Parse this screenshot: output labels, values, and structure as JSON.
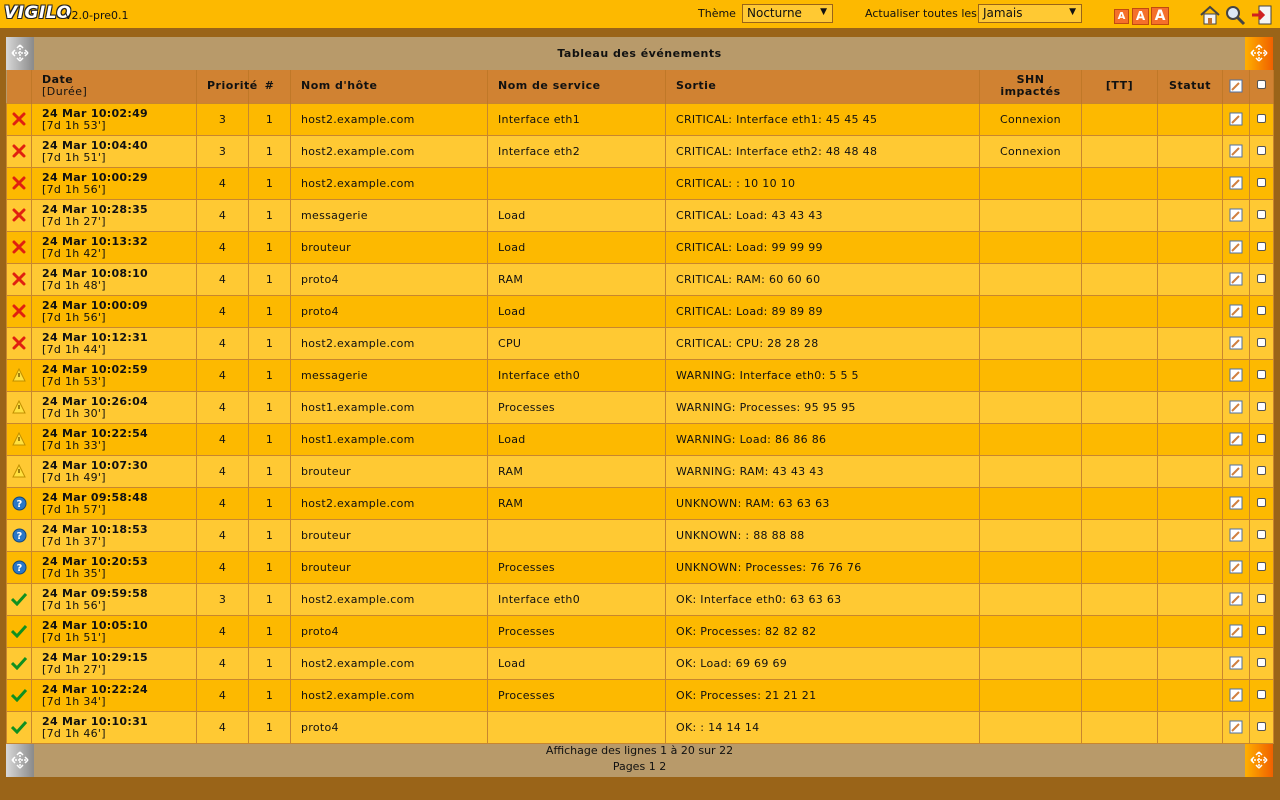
{
  "app": {
    "logo": "VIGILO",
    "version": "v2.0-pre0.1"
  },
  "toolbar": {
    "theme_label": "Thème",
    "theme_value": "Nocturne",
    "refresh_label": "Actualiser toutes les",
    "refresh_value": "Jamais",
    "font_sizes": [
      "A",
      "A",
      "A"
    ]
  },
  "panel": {
    "title": "Tableau des événements"
  },
  "columns": {
    "date": "Date",
    "date_sub": "[Durée]",
    "priority": "Priorité",
    "count": "#",
    "host": "Nom d'hôte",
    "service": "Nom de service",
    "output": "Sortie",
    "shn1": "SHN",
    "shn2": "impactés",
    "tt": "[TT]",
    "status": "Statut"
  },
  "rows": [
    {
      "state": "critical",
      "date": "24 Mar 10:02:49",
      "duration": "[7d 1h 53']",
      "priority": "3",
      "count": "1",
      "host": "host2.example.com",
      "service": "Interface eth1",
      "output": "CRITICAL: Interface eth1: 45 45 45",
      "shn": "Connexion",
      "tt": "",
      "status": ""
    },
    {
      "state": "critical",
      "date": "24 Mar 10:04:40",
      "duration": "[7d 1h 51']",
      "priority": "3",
      "count": "1",
      "host": "host2.example.com",
      "service": "Interface eth2",
      "output": "CRITICAL: Interface eth2: 48 48 48",
      "shn": "Connexion",
      "tt": "",
      "status": ""
    },
    {
      "state": "critical",
      "date": "24 Mar 10:00:29",
      "duration": "[7d 1h 56']",
      "priority": "4",
      "count": "1",
      "host": "host2.example.com",
      "service": "",
      "output": "CRITICAL: : 10 10 10",
      "shn": "",
      "tt": "",
      "status": ""
    },
    {
      "state": "critical",
      "date": "24 Mar 10:28:35",
      "duration": "[7d 1h 27']",
      "priority": "4",
      "count": "1",
      "host": "messagerie",
      "service": "Load",
      "output": "CRITICAL: Load: 43 43 43",
      "shn": "",
      "tt": "",
      "status": ""
    },
    {
      "state": "critical",
      "date": "24 Mar 10:13:32",
      "duration": "[7d 1h 42']",
      "priority": "4",
      "count": "1",
      "host": "brouteur",
      "service": "Load",
      "output": "CRITICAL: Load: 99 99 99",
      "shn": "",
      "tt": "",
      "status": ""
    },
    {
      "state": "critical",
      "date": "24 Mar 10:08:10",
      "duration": "[7d 1h 48']",
      "priority": "4",
      "count": "1",
      "host": "proto4",
      "service": "RAM",
      "output": "CRITICAL: RAM: 60 60 60",
      "shn": "",
      "tt": "",
      "status": ""
    },
    {
      "state": "critical",
      "date": "24 Mar 10:00:09",
      "duration": "[7d 1h 56']",
      "priority": "4",
      "count": "1",
      "host": "proto4",
      "service": "Load",
      "output": "CRITICAL: Load: 89 89 89",
      "shn": "",
      "tt": "",
      "status": ""
    },
    {
      "state": "critical",
      "date": "24 Mar 10:12:31",
      "duration": "[7d 1h 44']",
      "priority": "4",
      "count": "1",
      "host": "host2.example.com",
      "service": "CPU",
      "output": "CRITICAL: CPU: 28 28 28",
      "shn": "",
      "tt": "",
      "status": ""
    },
    {
      "state": "warning",
      "date": "24 Mar 10:02:59",
      "duration": "[7d 1h 53']",
      "priority": "4",
      "count": "1",
      "host": "messagerie",
      "service": "Interface eth0",
      "output": "WARNING: Interface eth0: 5 5 5",
      "shn": "",
      "tt": "",
      "status": ""
    },
    {
      "state": "warning",
      "date": "24 Mar 10:26:04",
      "duration": "[7d 1h 30']",
      "priority": "4",
      "count": "1",
      "host": "host1.example.com",
      "service": "Processes",
      "output": "WARNING: Processes: 95 95 95",
      "shn": "",
      "tt": "",
      "status": ""
    },
    {
      "state": "warning",
      "date": "24 Mar 10:22:54",
      "duration": "[7d 1h 33']",
      "priority": "4",
      "count": "1",
      "host": "host1.example.com",
      "service": "Load",
      "output": "WARNING: Load: 86 86 86",
      "shn": "",
      "tt": "",
      "status": ""
    },
    {
      "state": "warning",
      "date": "24 Mar 10:07:30",
      "duration": "[7d 1h 49']",
      "priority": "4",
      "count": "1",
      "host": "brouteur",
      "service": "RAM",
      "output": "WARNING: RAM: 43 43 43",
      "shn": "",
      "tt": "",
      "status": ""
    },
    {
      "state": "unknown",
      "date": "24 Mar 09:58:48",
      "duration": "[7d 1h 57']",
      "priority": "4",
      "count": "1",
      "host": "host2.example.com",
      "service": "RAM",
      "output": "UNKNOWN: RAM: 63 63 63",
      "shn": "",
      "tt": "",
      "status": ""
    },
    {
      "state": "unknown",
      "date": "24 Mar 10:18:53",
      "duration": "[7d 1h 37']",
      "priority": "4",
      "count": "1",
      "host": "brouteur",
      "service": "",
      "output": "UNKNOWN: : 88 88 88",
      "shn": "",
      "tt": "",
      "status": ""
    },
    {
      "state": "unknown",
      "date": "24 Mar 10:20:53",
      "duration": "[7d 1h 35']",
      "priority": "4",
      "count": "1",
      "host": "brouteur",
      "service": "Processes",
      "output": "UNKNOWN: Processes: 76 76 76",
      "shn": "",
      "tt": "",
      "status": ""
    },
    {
      "state": "ok",
      "date": "24 Mar 09:59:58",
      "duration": "[7d 1h 56']",
      "priority": "3",
      "count": "1",
      "host": "host2.example.com",
      "service": "Interface eth0",
      "output": "OK: Interface eth0: 63 63 63",
      "shn": "",
      "tt": "",
      "status": ""
    },
    {
      "state": "ok",
      "date": "24 Mar 10:05:10",
      "duration": "[7d 1h 51']",
      "priority": "4",
      "count": "1",
      "host": "proto4",
      "service": "Processes",
      "output": "OK: Processes: 82 82 82",
      "shn": "",
      "tt": "",
      "status": ""
    },
    {
      "state": "ok",
      "date": "24 Mar 10:29:15",
      "duration": "[7d 1h 27']",
      "priority": "4",
      "count": "1",
      "host": "host2.example.com",
      "service": "Load",
      "output": "OK: Load: 69 69 69",
      "shn": "",
      "tt": "",
      "status": ""
    },
    {
      "state": "ok",
      "date": "24 Mar 10:22:24",
      "duration": "[7d 1h 34']",
      "priority": "4",
      "count": "1",
      "host": "host2.example.com",
      "service": "Processes",
      "output": "OK: Processes: 21 21 21",
      "shn": "",
      "tt": "",
      "status": ""
    },
    {
      "state": "ok",
      "date": "24 Mar 10:10:31",
      "duration": "[7d 1h 46']",
      "priority": "4",
      "count": "1",
      "host": "proto4",
      "service": "",
      "output": "OK: : 14 14 14",
      "shn": "",
      "tt": "",
      "status": ""
    }
  ],
  "pager": {
    "summary": "Affichage des lignes 1 à 20 sur 22",
    "pages_label": "Pages",
    "pages": [
      "1",
      "2"
    ]
  },
  "colors": {
    "row_even": "#fdb900",
    "row_odd": "#ffc933",
    "header": "#d08232",
    "panel": "#b89a6a",
    "background": "#9a6418"
  }
}
